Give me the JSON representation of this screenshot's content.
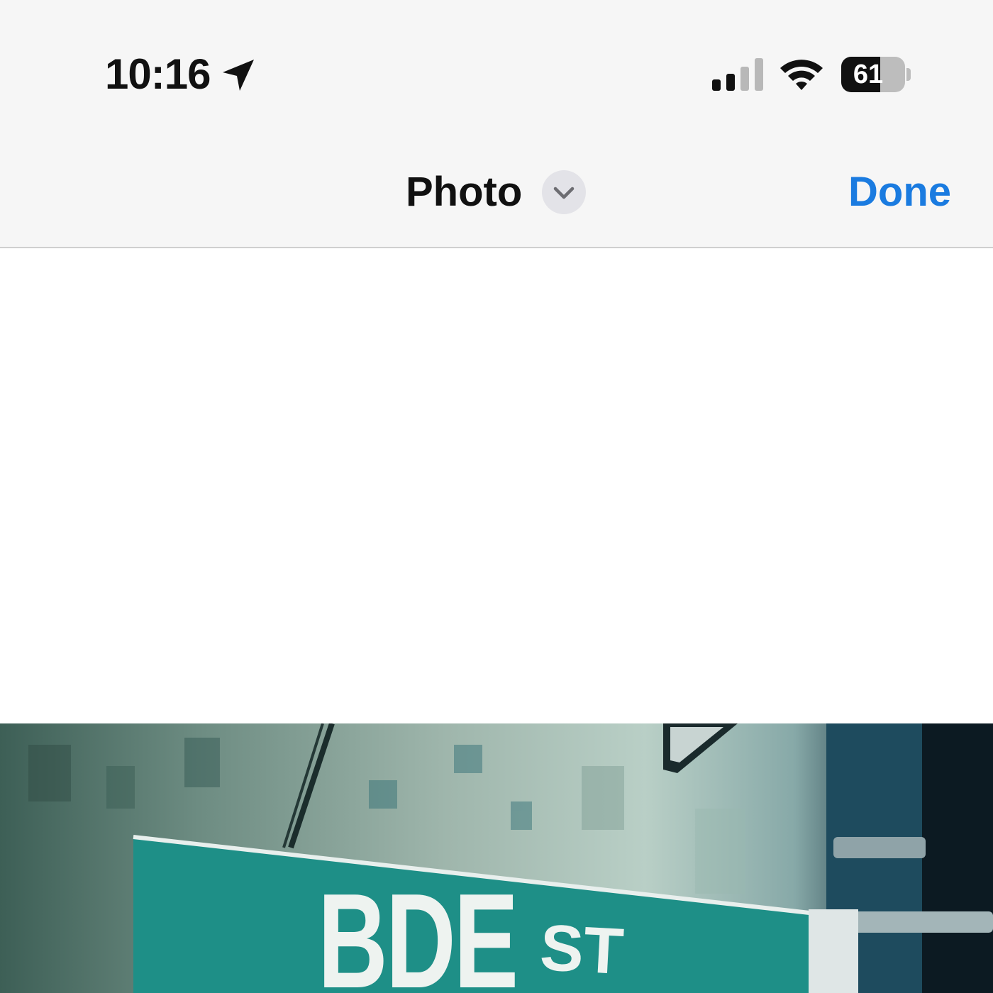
{
  "status_bar": {
    "time": "10:16",
    "battery_percent": "61",
    "battery_level": 0.61,
    "signal_bars_active": 2,
    "signal_bars_total": 4
  },
  "nav": {
    "title": "Photo",
    "done_label": "Done"
  },
  "photo": {
    "sign_name": "BDE",
    "sign_suffix": "ST"
  },
  "colors": {
    "accent": "#1a7be0",
    "sign_green": "#1e8f87",
    "chrome_bg": "#f6f6f6"
  }
}
